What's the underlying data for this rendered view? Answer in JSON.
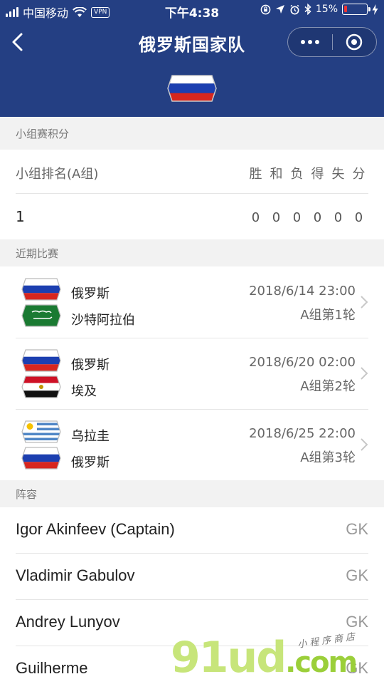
{
  "status_bar": {
    "carrier": "中国移动",
    "vpn": "VPN",
    "time": "下午4:38",
    "battery": "15%",
    "battery_level": 0.15
  },
  "nav": {
    "title": "俄罗斯国家队",
    "back_icon": "chevron-left-icon",
    "more_icon": "more-dots-icon",
    "close_icon": "target-close-icon"
  },
  "colors": {
    "header_bg": "#243f83",
    "section_bg": "#f2f2f2",
    "text_main": "#222222",
    "text_secondary": "#666666"
  },
  "standings": {
    "section_title": "小组赛积分",
    "group_label": "小组排名(A组)",
    "columns": [
      "胜",
      "和",
      "负",
      "得",
      "失",
      "分"
    ],
    "row": {
      "rank": "1",
      "values": [
        "0",
        "0",
        "0",
        "0",
        "0",
        "0"
      ]
    }
  },
  "matches": {
    "section_title": "近期比赛",
    "items": [
      {
        "team1": "俄罗斯",
        "team2": "沙特阿拉伯",
        "date": "2018/6/14 23:00",
        "round": "A组第1轮",
        "flag1": "russia",
        "flag2": "saudi-arabia"
      },
      {
        "team1": "俄罗斯",
        "team2": "埃及",
        "date": "2018/6/20 02:00",
        "round": "A组第2轮",
        "flag1": "russia",
        "flag2": "egypt"
      },
      {
        "team1": "乌拉圭",
        "team2": "俄罗斯",
        "date": "2018/6/25 22:00",
        "round": "A组第3轮",
        "flag1": "uruguay",
        "flag2": "russia"
      }
    ]
  },
  "roster": {
    "section_title": "阵容",
    "players": [
      {
        "name": "Igor Akinfeev (Captain)",
        "position": "GK"
      },
      {
        "name": "Vladimir Gabulov",
        "position": "GK"
      },
      {
        "name": "Andrey Lunyov",
        "position": "GK"
      },
      {
        "name": "Guilherme",
        "position": "GK"
      }
    ]
  },
  "watermark": {
    "brand": "91ud",
    "tld": ".com",
    "tagline": "小程序商店"
  }
}
